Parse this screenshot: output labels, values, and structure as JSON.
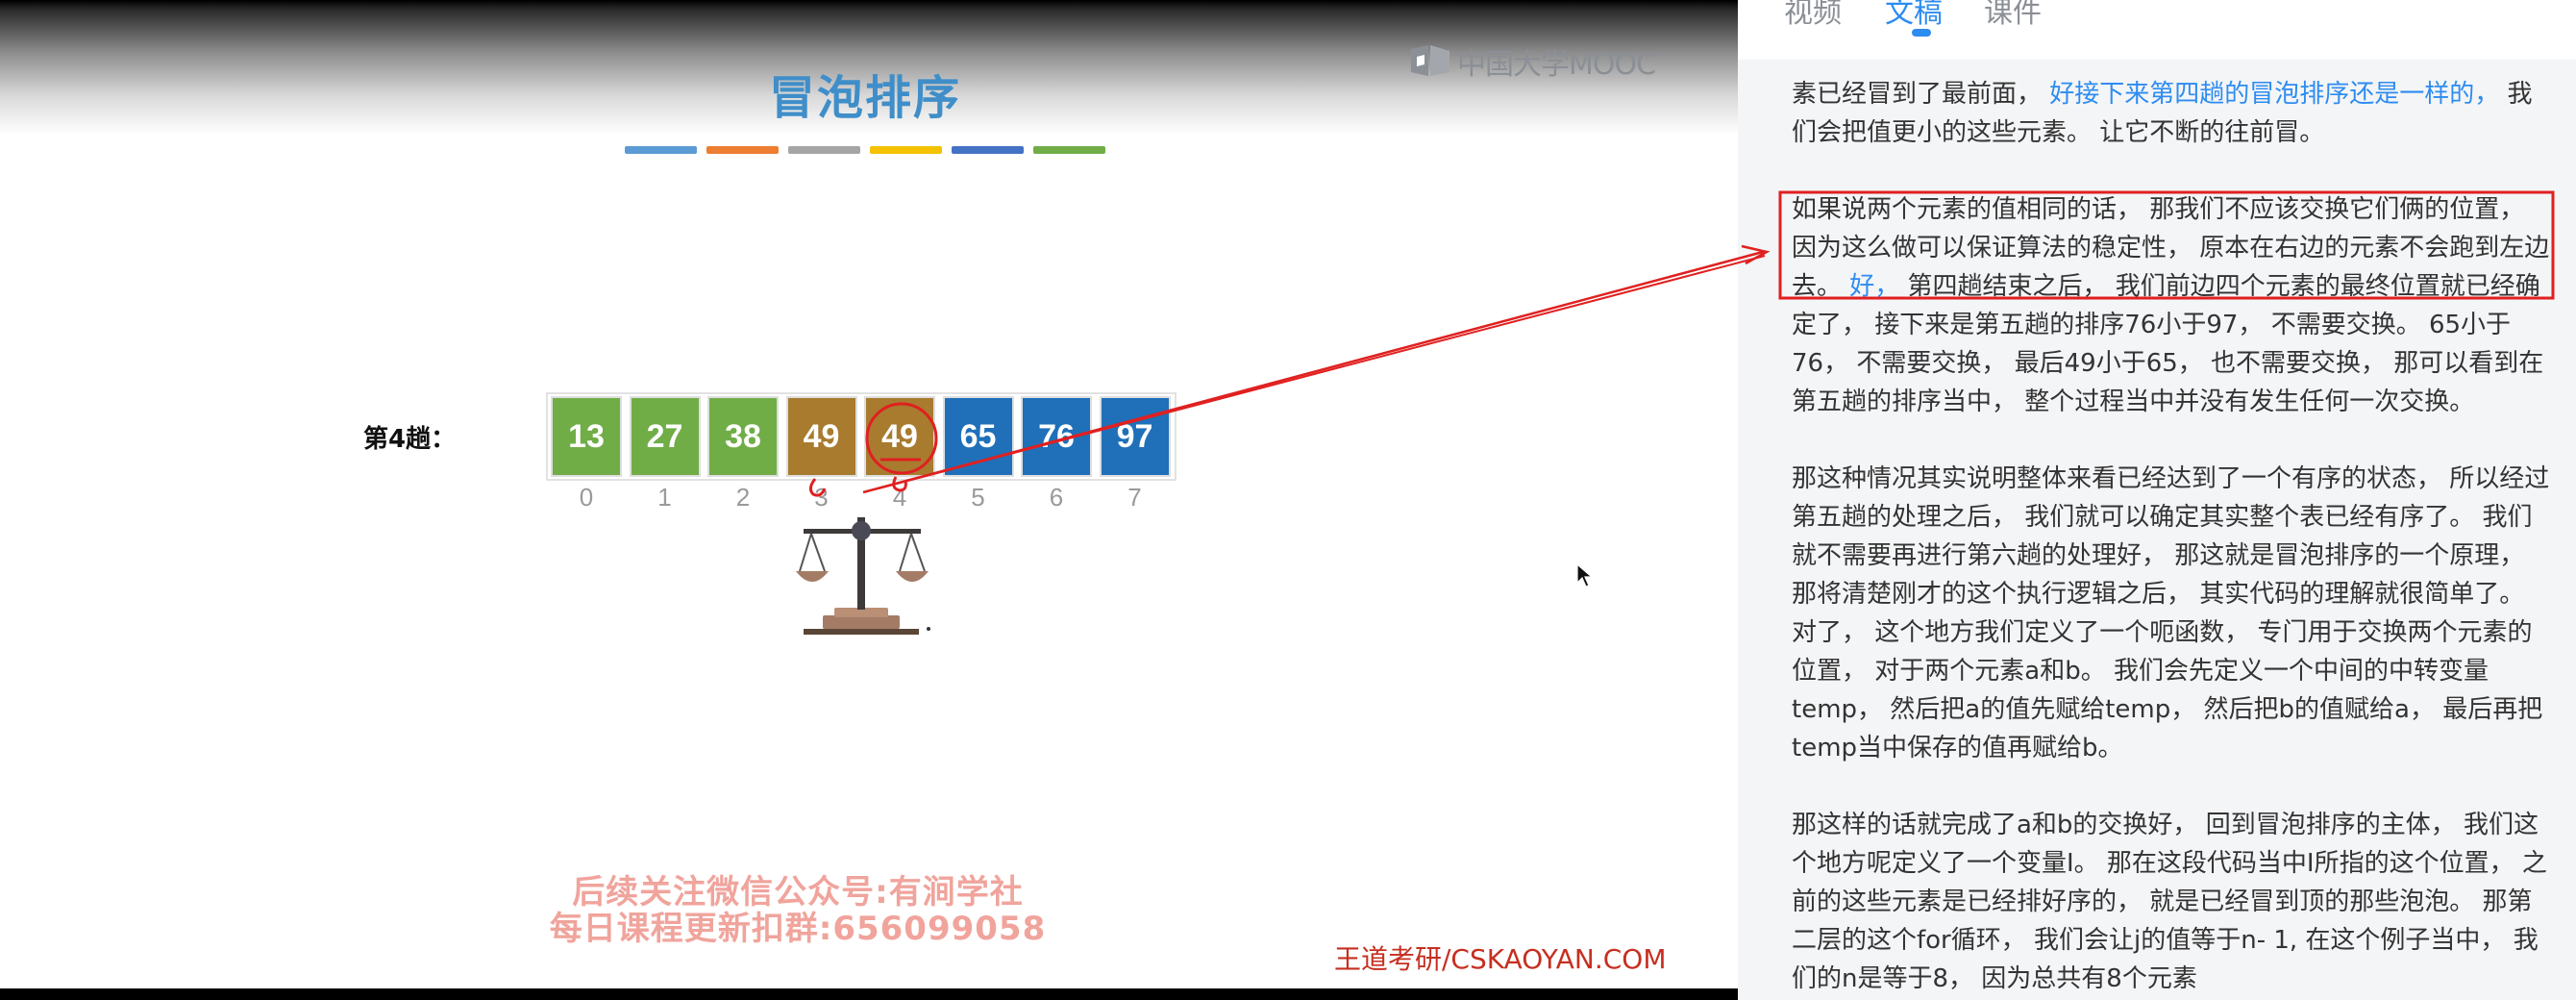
{
  "slide": {
    "logo_text": "中国大学MOOC",
    "title": "冒泡排序",
    "color_strip": [
      "#5b9bd5",
      "#ed7d31",
      "#a5a5a5",
      "#f4c200",
      "#4472c4",
      "#70ad47"
    ],
    "pass_label": "第4趟：",
    "cells": [
      {
        "value": "13",
        "index": "0",
        "color": "#70ad47"
      },
      {
        "value": "27",
        "index": "1",
        "color": "#70ad47"
      },
      {
        "value": "38",
        "index": "2",
        "color": "#70ad47"
      },
      {
        "value": "49",
        "index": "3",
        "color": "#a87b2f"
      },
      {
        "value": "49",
        "index": "4",
        "color": "#a87b2f"
      },
      {
        "value": "65",
        "index": "5",
        "color": "#1f70b9"
      },
      {
        "value": "76",
        "index": "6",
        "color": "#1f70b9"
      },
      {
        "value": "97",
        "index": "7",
        "color": "#1f70b9"
      }
    ],
    "promo_line1": "后续关注微信公众号:有涧学社",
    "promo_line2": "每日课程更新扣群:656099058",
    "watermark": "王道考研/CSKAOYAN.COM"
  },
  "panel": {
    "tabs": [
      {
        "label": "视频",
        "active": false
      },
      {
        "label": "文稿",
        "active": true
      },
      {
        "label": "课件",
        "active": false
      }
    ],
    "p1": {
      "a": "素已经冒到了最前面， ",
      "b": "好接下来第四趟的冒泡排序还是一样的，",
      "c": " 我们会把值更小的这些元素。 让它不断的往前冒。"
    },
    "p2": {
      "a": "如果说两个元素的值相同的话， 那我们不应该交换它们俩的位置， 因为这么做可以保证算法的稳定性， 原本在右边的元素不会跑到左边去。 ",
      "b": "好，",
      "c": " 第四趟结束之后， 我们前边四个元素的最终位置就已经确定了， 接下来是第五趟的排序76小于97， 不需要交换。 65小于76， 不需要交换， 最后49小于65， 也不需要交换， 那可以看到在第五趟的排序当中， 整个过程当中并没有发生任何一次交换。"
    },
    "p3": "那这种情况其实说明整体来看已经达到了一个有序的状态， 所以经过第五趟的处理之后， 我们就可以确定其实整个表已经有序了。 我们就不需要再进行第六趟的处理好， 那这就是冒泡排序的一个原理， 那将清楚刚才的这个执行逻辑之后， 其实代码的理解就很简单了。 对了， 这个地方我们定义了一个呃函数， 专门用于交换两个元素的位置， 对于两个元素a和b。 我们会先定义一个中间的中转变量temp， 然后把a的值先赋给temp， 然后把b的值赋给a， 最后再把temp当中保存的值再赋给b。",
    "p4": "那这样的话就完成了a和b的交换好， 回到冒泡排序的主体， 我们这个地方呢定义了一个变量I。 那在这段代码当中I所指的这个位置， 之前的这些元素是已经排好序的， 就是已经冒到顶的那些泡泡。 那第二层的这个for循环， 我们会让j的值等于n- 1, 在这个例子当中， 我们的n是等于8， 因为总共有8个元素"
  }
}
